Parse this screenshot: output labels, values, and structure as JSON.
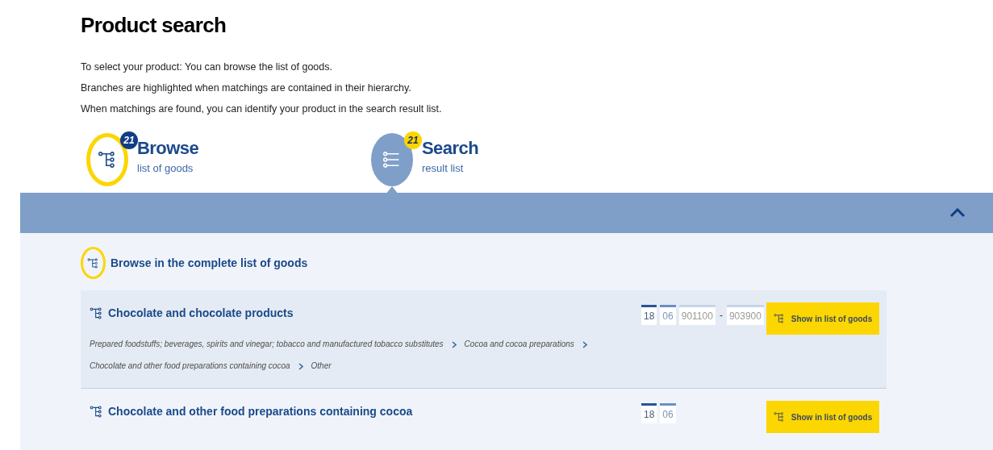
{
  "title": "Product search",
  "intro": [
    "To select your product: You can browse the list of goods.",
    "Branches are highlighted when matchings are contained in their hierarchy.",
    "When matchings are found, you can identify your product in the search result list."
  ],
  "tabs": [
    {
      "title": "Browse",
      "subtitle": "list of goods",
      "count": "21",
      "selected": false,
      "kind": "tree"
    },
    {
      "title": "Search",
      "subtitle": "result list",
      "count": "21",
      "selected": true,
      "kind": "list"
    }
  ],
  "panel": {
    "expanded": true,
    "browse_link": "Browse in the complete list of goods"
  },
  "results": [
    {
      "title": "Chocolate and chocolate products",
      "highlighted": true,
      "codes": [
        "18",
        "06",
        "901100",
        "903900"
      ],
      "range_separator": "-",
      "path": [
        "Prepared foodstuffs; beverages, spirits and vinegar; tobacco and manufactured tobacco substitutes",
        "Cocoa and cocoa preparations",
        "Chocolate and other food preparations containing cocoa",
        "Other"
      ],
      "button": "Show in list of goods"
    },
    {
      "title": "Chocolate and other food preparations containing cocoa",
      "highlighted": false,
      "codes": [
        "18",
        "06"
      ],
      "button": "Show in list of goods"
    }
  ]
}
